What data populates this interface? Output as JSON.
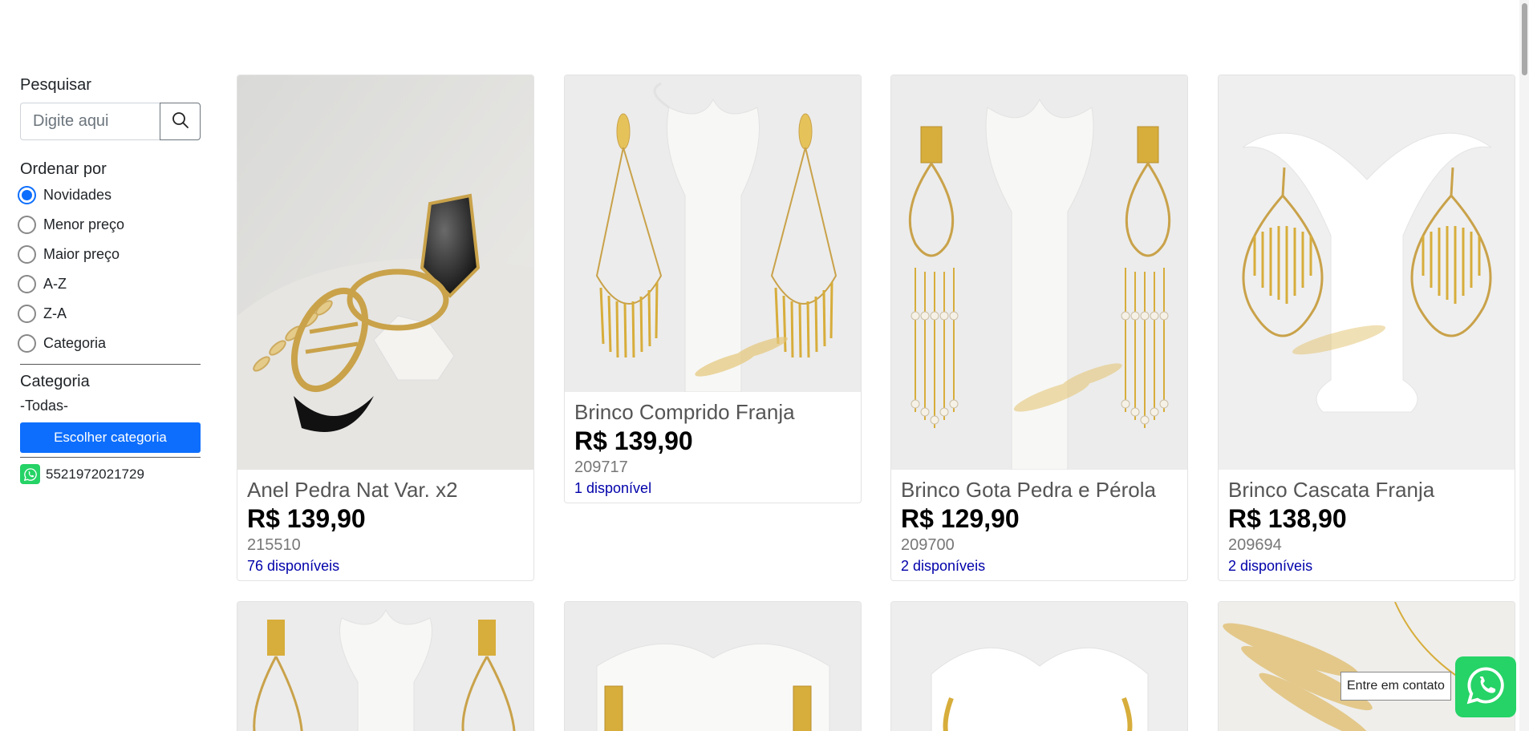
{
  "search": {
    "label": "Pesquisar",
    "placeholder": "Digite aqui"
  },
  "sort": {
    "label": "Ordenar por",
    "options": [
      "Novidades",
      "Menor preço",
      "Maior preço",
      "A-Z",
      "Z-A",
      "Categoria"
    ],
    "selected": "Novidades"
  },
  "category": {
    "label": "Categoria",
    "value": "-Todas-",
    "button": "Escolher categoria"
  },
  "contact": {
    "phone": "5521972021729",
    "tooltip": "Entre em contato"
  },
  "products": [
    {
      "name": "Anel Pedra Nat Var. x2",
      "price": "R$ 139,90",
      "code": "215510",
      "stock": "76 disponíveis"
    },
    {
      "name": "Brinco Comprido Franja",
      "price": "R$ 139,90",
      "code": "209717",
      "stock": "1 disponível"
    },
    {
      "name": "Brinco Gota Pedra e Pérola",
      "price": "R$ 129,90",
      "code": "209700",
      "stock": "2 disponíveis"
    },
    {
      "name": "Brinco Cascata Franja",
      "price": "R$ 138,90",
      "code": "209694",
      "stock": "2 disponíveis"
    }
  ],
  "colors": {
    "accent": "#0d6efd",
    "whatsapp": "#25d366",
    "stock": "#0000aa"
  }
}
